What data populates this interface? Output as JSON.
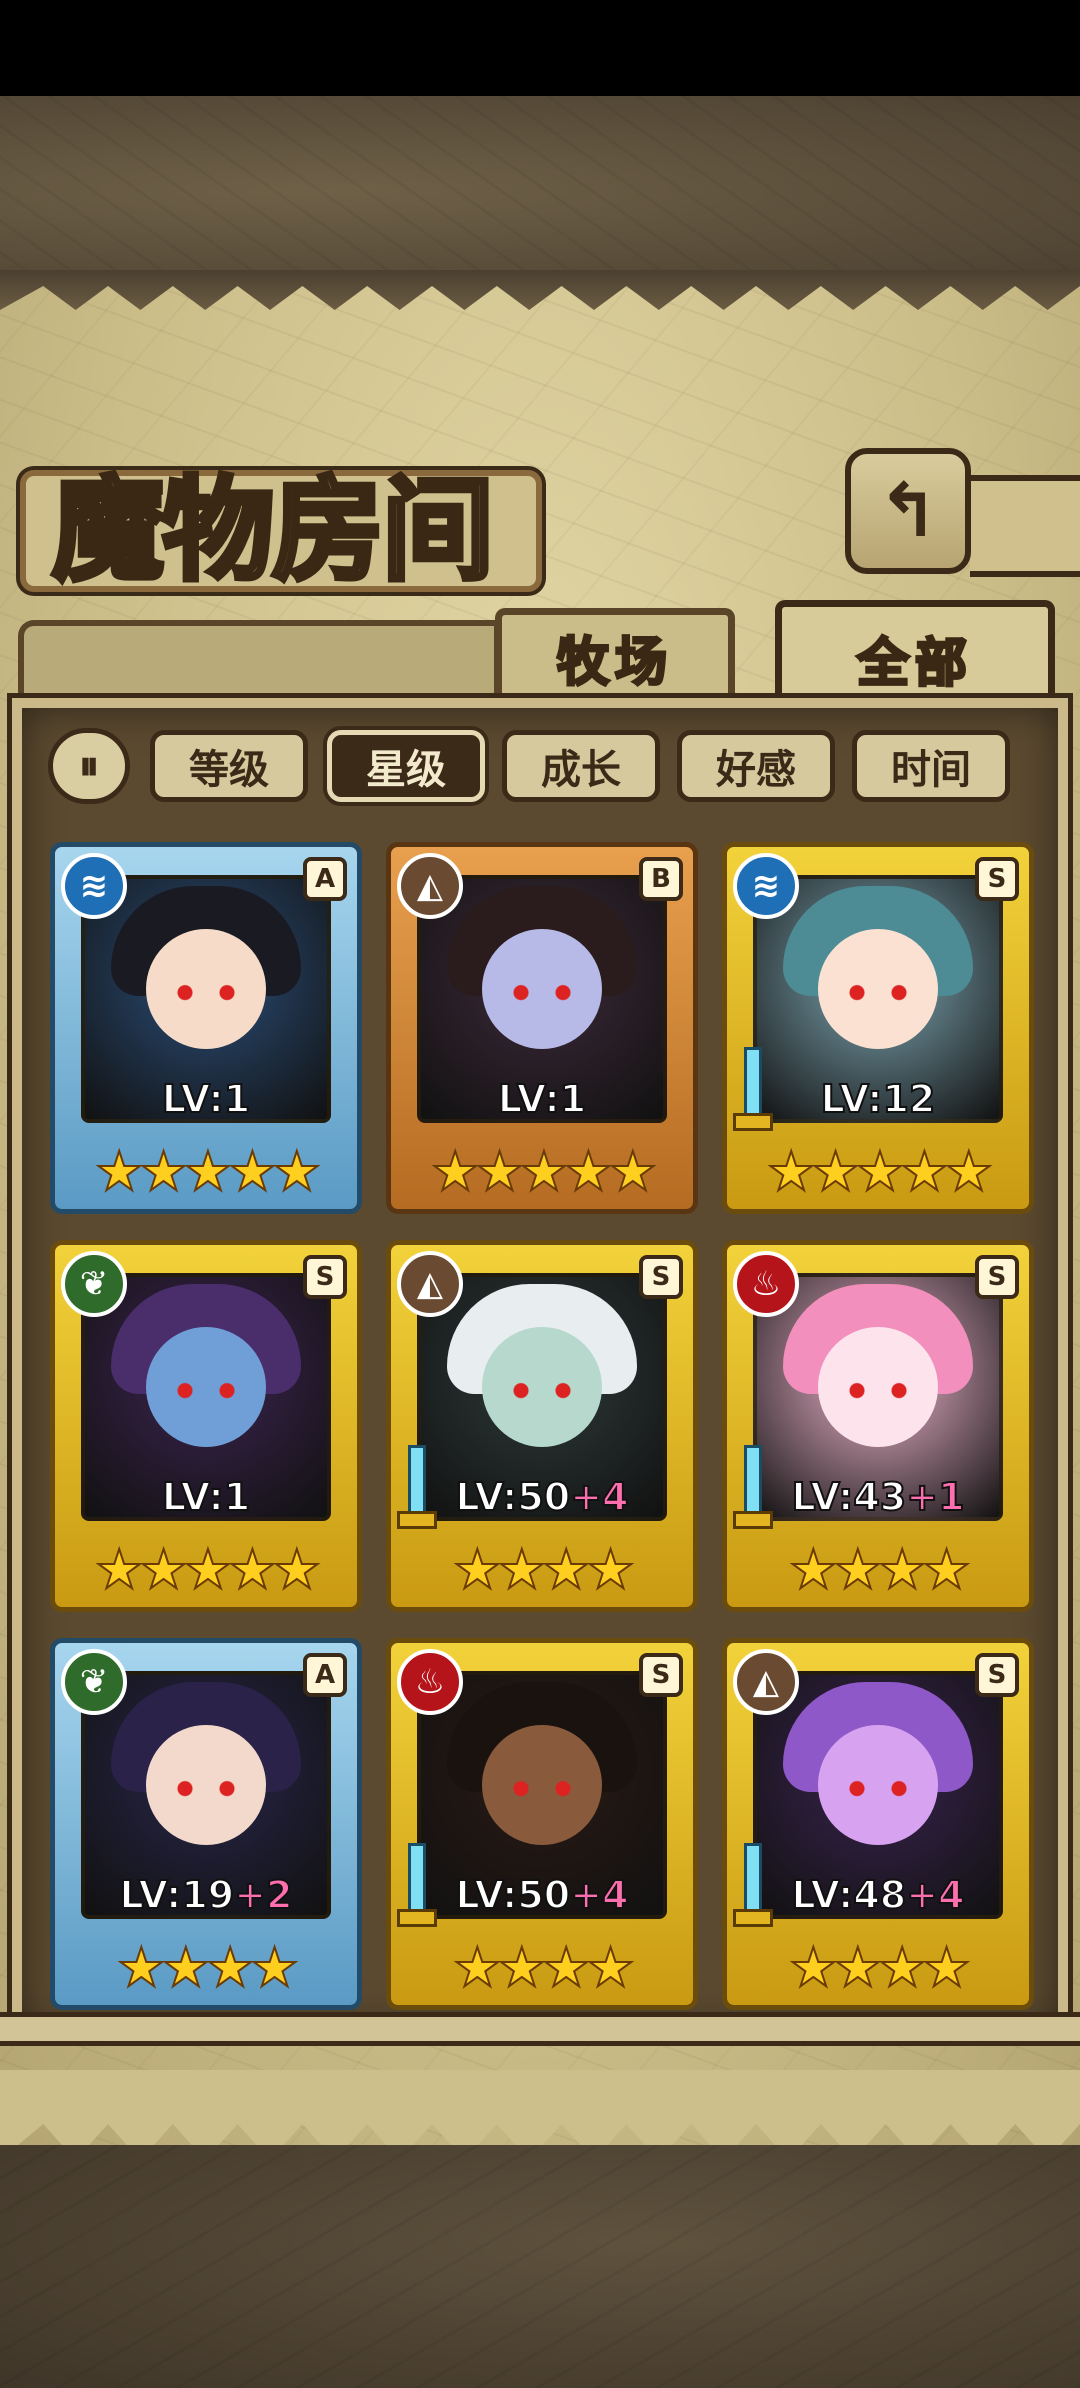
{
  "title": "魔物房间",
  "back_icon": "↰",
  "tabs": [
    {
      "label": "牧场",
      "active": false
    },
    {
      "label": "全部",
      "active": true
    }
  ],
  "sort": {
    "toggle_icon": "⏸",
    "buttons": [
      {
        "label": "等级",
        "active": false
      },
      {
        "label": "星级",
        "active": true
      },
      {
        "label": "成长",
        "active": false
      },
      {
        "label": "好感",
        "active": false
      },
      {
        "label": "时间",
        "active": false
      }
    ]
  },
  "monsters": [
    {
      "lv": "LV:1",
      "plus": "",
      "rank": "A",
      "element": "water",
      "element_icon": "≋",
      "stars": "★★★★★",
      "frame": "blue",
      "has_weapon": false
    },
    {
      "lv": "LV:1",
      "plus": "",
      "rank": "B",
      "element": "earth",
      "element_icon": "◭",
      "stars": "★★★★★",
      "frame": "orange",
      "has_weapon": false
    },
    {
      "lv": "LV:12",
      "plus": "",
      "rank": "S",
      "element": "water",
      "element_icon": "≋",
      "stars": "★★★★★",
      "frame": "gold",
      "has_weapon": true
    },
    {
      "lv": "LV:1",
      "plus": "",
      "rank": "S",
      "element": "nature",
      "element_icon": "❦",
      "stars": "★★★★★",
      "frame": "gold",
      "has_weapon": false
    },
    {
      "lv": "LV:50",
      "plus": "+4",
      "rank": "S",
      "element": "earth",
      "element_icon": "◭",
      "stars": "★★★★",
      "frame": "gold",
      "has_weapon": true
    },
    {
      "lv": "LV:43",
      "plus": "+1",
      "rank": "S",
      "element": "fire",
      "element_icon": "♨",
      "stars": "★★★★",
      "frame": "gold",
      "has_weapon": true
    },
    {
      "lv": "LV:19",
      "plus": "+2",
      "rank": "A",
      "element": "nature",
      "element_icon": "❦",
      "stars": "★★★★",
      "frame": "blue",
      "has_weapon": false
    },
    {
      "lv": "LV:50",
      "plus": "+4",
      "rank": "S",
      "element": "fire",
      "element_icon": "♨",
      "stars": "★★★★",
      "frame": "gold",
      "has_weapon": true
    },
    {
      "lv": "LV:48",
      "plus": "+4",
      "rank": "S",
      "element": "earth",
      "element_icon": "◭",
      "stars": "★★★★",
      "frame": "gold",
      "has_weapon": true
    }
  ]
}
